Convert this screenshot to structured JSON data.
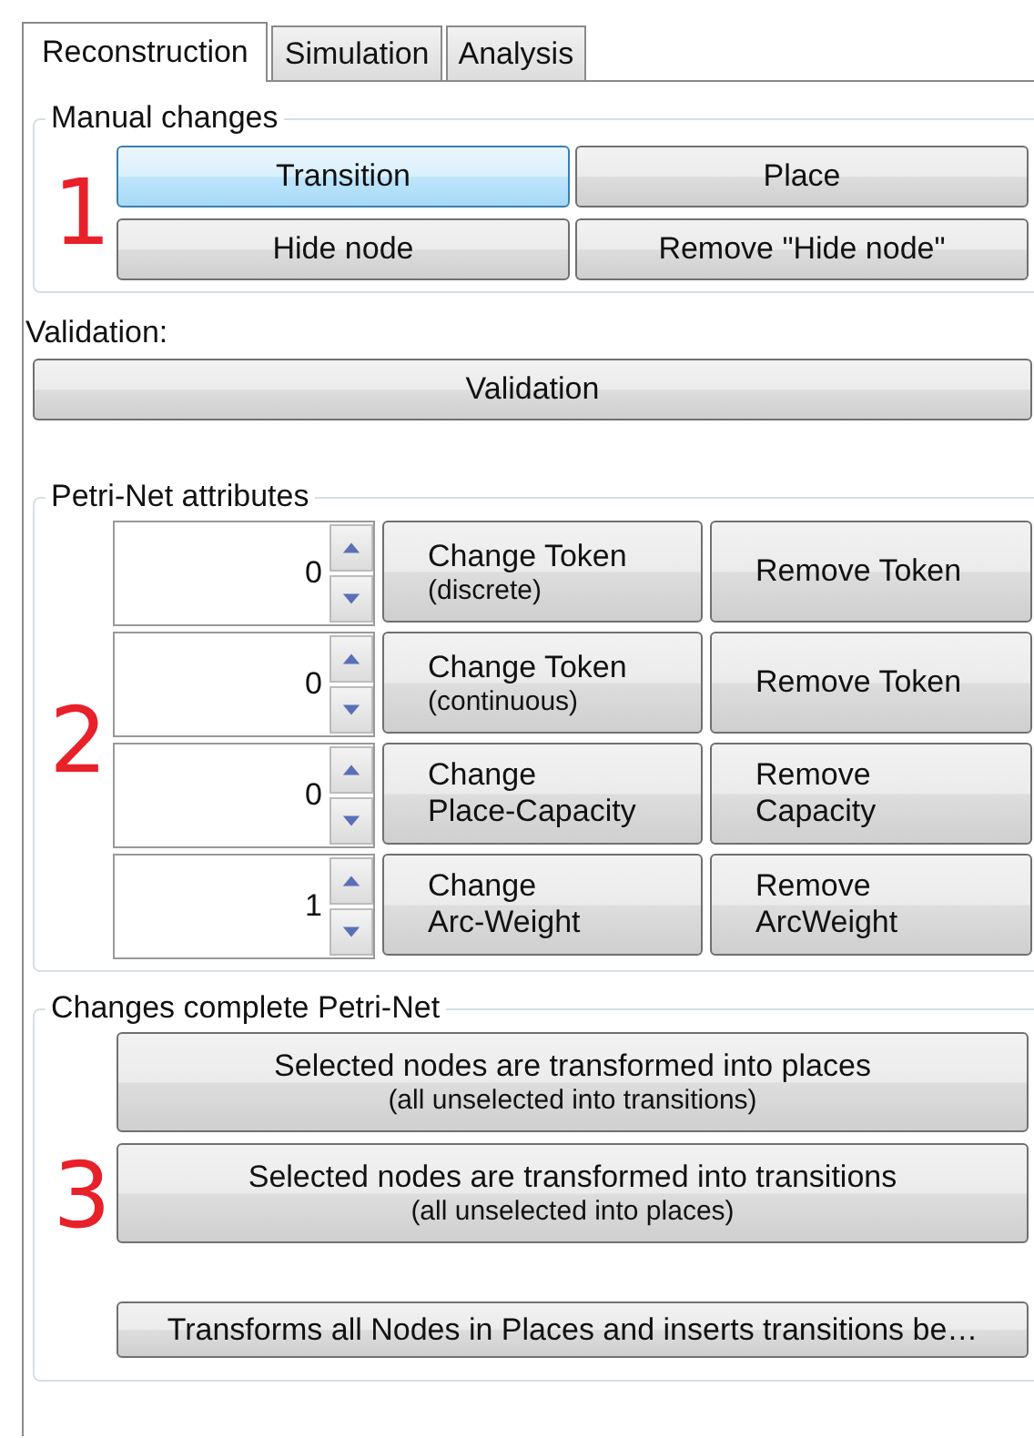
{
  "tabs": [
    {
      "label": "Reconstruction",
      "selected": true
    },
    {
      "label": "Simulation",
      "selected": false
    },
    {
      "label": "Analysis",
      "selected": false
    }
  ],
  "manual_changes": {
    "title": "Manual changes",
    "marker": "1",
    "buttons": [
      {
        "label": "Transition",
        "selected": true
      },
      {
        "label": "Place",
        "selected": false
      },
      {
        "label": "Hide node",
        "selected": false
      },
      {
        "label": "Remove \"Hide node\"",
        "selected": false
      }
    ]
  },
  "validation": {
    "label": "Validation:",
    "button": "Validation"
  },
  "attributes": {
    "title": "Petri-Net attributes",
    "marker": "2",
    "rows": [
      {
        "value": "0",
        "change": [
          "Change Token",
          "(discrete)"
        ],
        "remove": [
          "Remove Token"
        ]
      },
      {
        "value": "0",
        "change": [
          "Change Token",
          "(continuous)"
        ],
        "remove": [
          "Remove Token"
        ]
      },
      {
        "value": "0",
        "change": [
          "Change",
          "Place-Capacity"
        ],
        "remove": [
          "Remove",
          "Capacity"
        ]
      },
      {
        "value": "1",
        "change": [
          "Change",
          "Arc-Weight"
        ],
        "remove": [
          "Remove",
          "ArcWeight"
        ]
      }
    ]
  },
  "complete": {
    "title": "Changes complete Petri-Net",
    "marker": "3",
    "buttons": [
      {
        "lines": [
          "Selected nodes are transformed into places",
          "(all unselected into transitions)"
        ]
      },
      {
        "lines": [
          "Selected nodes are transformed into transitions",
          "(all unselected into places)"
        ]
      },
      {
        "lines": [
          "Transforms all Nodes in Places and inserts transitions be…"
        ]
      }
    ]
  }
}
